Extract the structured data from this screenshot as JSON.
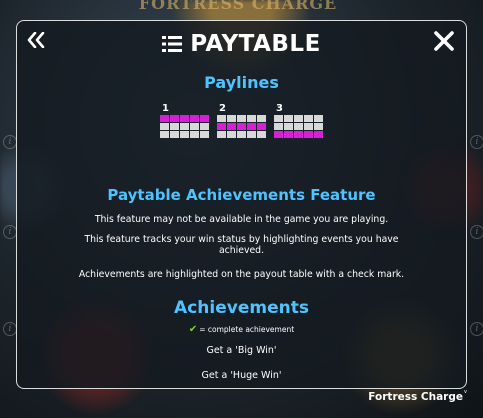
{
  "background": {
    "game_logo_text": "FORTRESS CHARGE",
    "info_glyph": "i"
  },
  "header": {
    "back_icon": "double-chevron-left-icon",
    "menu_icon": "hamburger-menu-icon",
    "title": "PAYTABLE",
    "close_icon": "close-x-icon"
  },
  "paylines": {
    "heading": "Paylines",
    "items": [
      {
        "number": "1",
        "rows": [
          [
            1,
            1,
            1,
            1,
            1
          ],
          [
            0,
            0,
            0,
            0,
            0
          ],
          [
            0,
            0,
            0,
            0,
            0
          ]
        ]
      },
      {
        "number": "2",
        "rows": [
          [
            0,
            0,
            0,
            0,
            0
          ],
          [
            1,
            1,
            1,
            1,
            1
          ],
          [
            0,
            0,
            0,
            0,
            0
          ]
        ]
      },
      {
        "number": "3",
        "rows": [
          [
            0,
            0,
            0,
            0,
            0
          ],
          [
            0,
            0,
            0,
            0,
            0
          ],
          [
            1,
            1,
            1,
            1,
            1
          ]
        ]
      }
    ],
    "active_color": "#d61fd6",
    "inactive_color": "#d8d8d8"
  },
  "achievements_feature": {
    "heading": "Paytable Achievements Feature",
    "paragraphs": [
      "This feature may not be available in the game you are playing.",
      "This feature tracks your win status by highlighting events you have achieved.",
      "Achievements are highlighted on the payout table with a check mark."
    ]
  },
  "achievements": {
    "heading": "Achievements",
    "legend_check": "✔",
    "legend_text": "= complete achievement",
    "items": [
      "Get a 'Big Win'",
      "Get a 'Huge Win'"
    ]
  },
  "footer": {
    "game_name": "Fortress Charge",
    "version_marker": "v"
  },
  "colors": {
    "heading_blue": "#4fc3ff",
    "check_green": "#7cd634"
  }
}
